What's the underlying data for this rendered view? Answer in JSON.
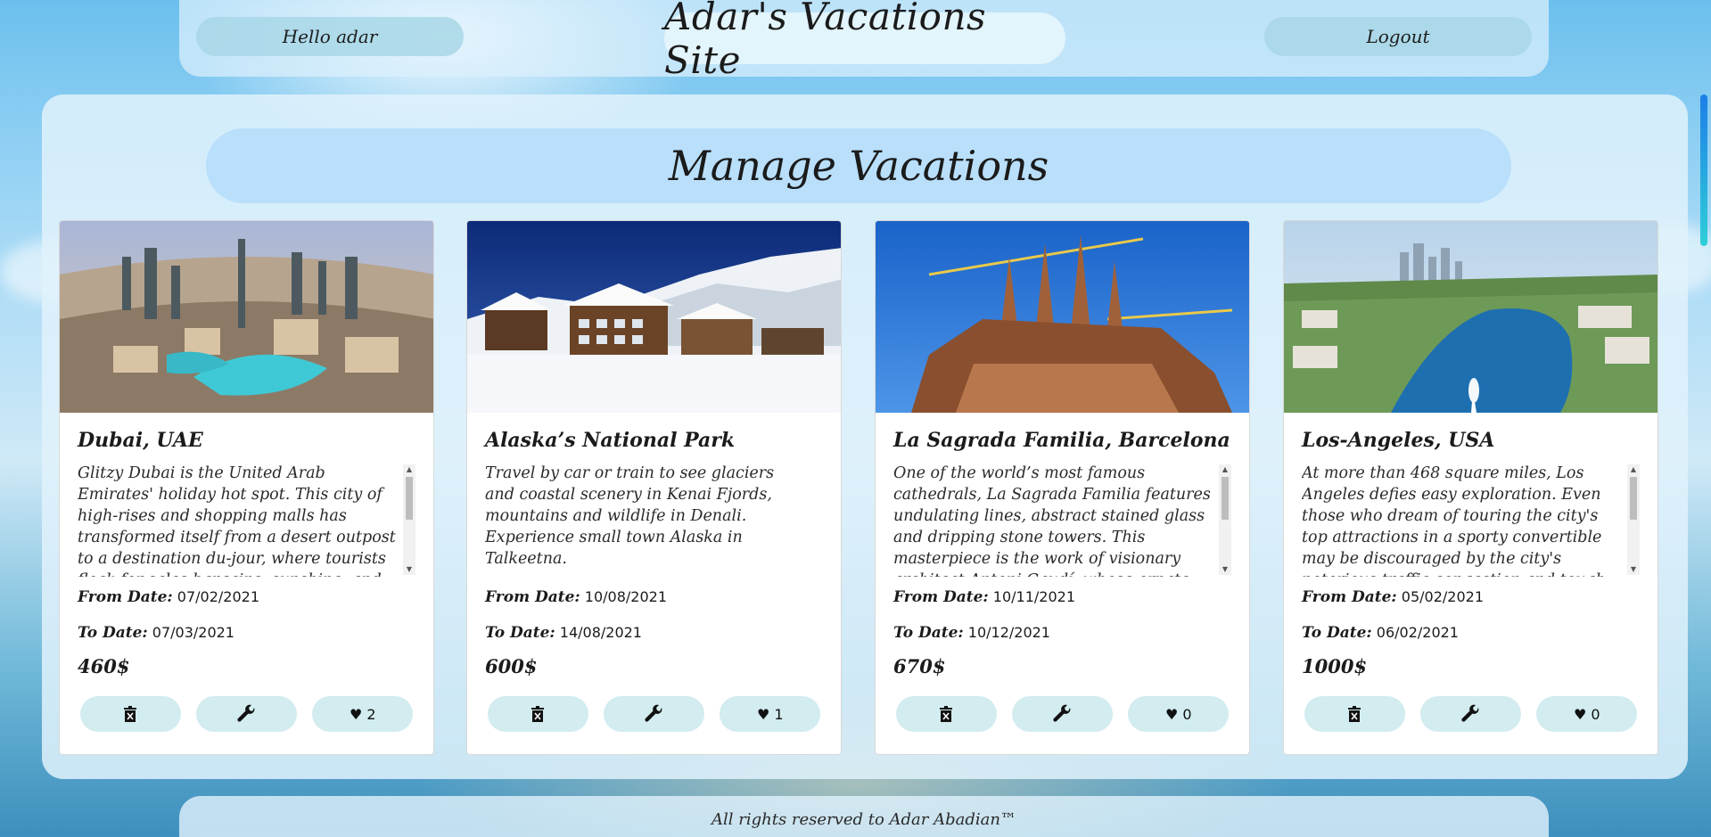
{
  "header": {
    "greeting": "Hello adar",
    "site_title": "Adar's Vacations Site",
    "logout_label": "Logout"
  },
  "main": {
    "title": "Manage Vacations"
  },
  "labels": {
    "from_date": "From Date:",
    "to_date": "To Date:"
  },
  "vacations": [
    {
      "title": "Dubai, UAE",
      "description": "Glitzy Dubai is the United Arab Emirates' holiday hot spot. This city of high-rises and shopping malls has transformed itself from a desert outpost to a destination du-jour, where tourists flock for sales bargains, sunshine, and family fun. Dubai is famous for",
      "from_date": "07/02/2021",
      "to_date": "07/03/2021",
      "price": "460$",
      "followers": "♥ 2",
      "image_icon": "dubai-city-photo"
    },
    {
      "title": "Alaska’s National Park",
      "description": "Travel by car or train to see glaciers and coastal scenery in Kenai Fjords, mountains and wildlife in Denali. Experience small town Alaska in Talkeetna.",
      "from_date": "10/08/2021",
      "to_date": "14/08/2021",
      "price": "600$",
      "followers": "♥ 1",
      "image_icon": "alaska-snow-lodge-photo"
    },
    {
      "title": "La Sagrada Familia, Barcelona",
      "description": "One of the world’s most famous cathedrals, La Sagrada Familia features undulating lines, abstract stained glass and dripping stone towers. This masterpiece is the work of visionary architect Antoni Gaudí, whose ornate private commissions and playful Barc",
      "from_date": "10/11/2021",
      "to_date": "10/12/2021",
      "price": "670$",
      "followers": "♥ 0",
      "image_icon": "sagrada-familia-photo"
    },
    {
      "title": "Los-Angeles, USA",
      "description": "At more than 468 square miles, Los Angeles defies easy exploration. Even those who dream of touring the city's top attractions in a sporty convertible may be discouraged by the city's notorious traffic congestion and tough parking rules. To enjoy that stress-free",
      "from_date": "05/02/2021",
      "to_date": "06/02/2021",
      "price": "1000$",
      "followers": "♥ 0",
      "image_icon": "los-angeles-lake-photo"
    }
  ],
  "footer": {
    "text": "All rights reserved to Adar Abadian™"
  },
  "colors": {
    "pill_bg": "#a8d7e6",
    "card_button_bg": "#d2ecef",
    "title_bg": "#b4dcfa",
    "scroll_accent": "#1e7ee8"
  }
}
